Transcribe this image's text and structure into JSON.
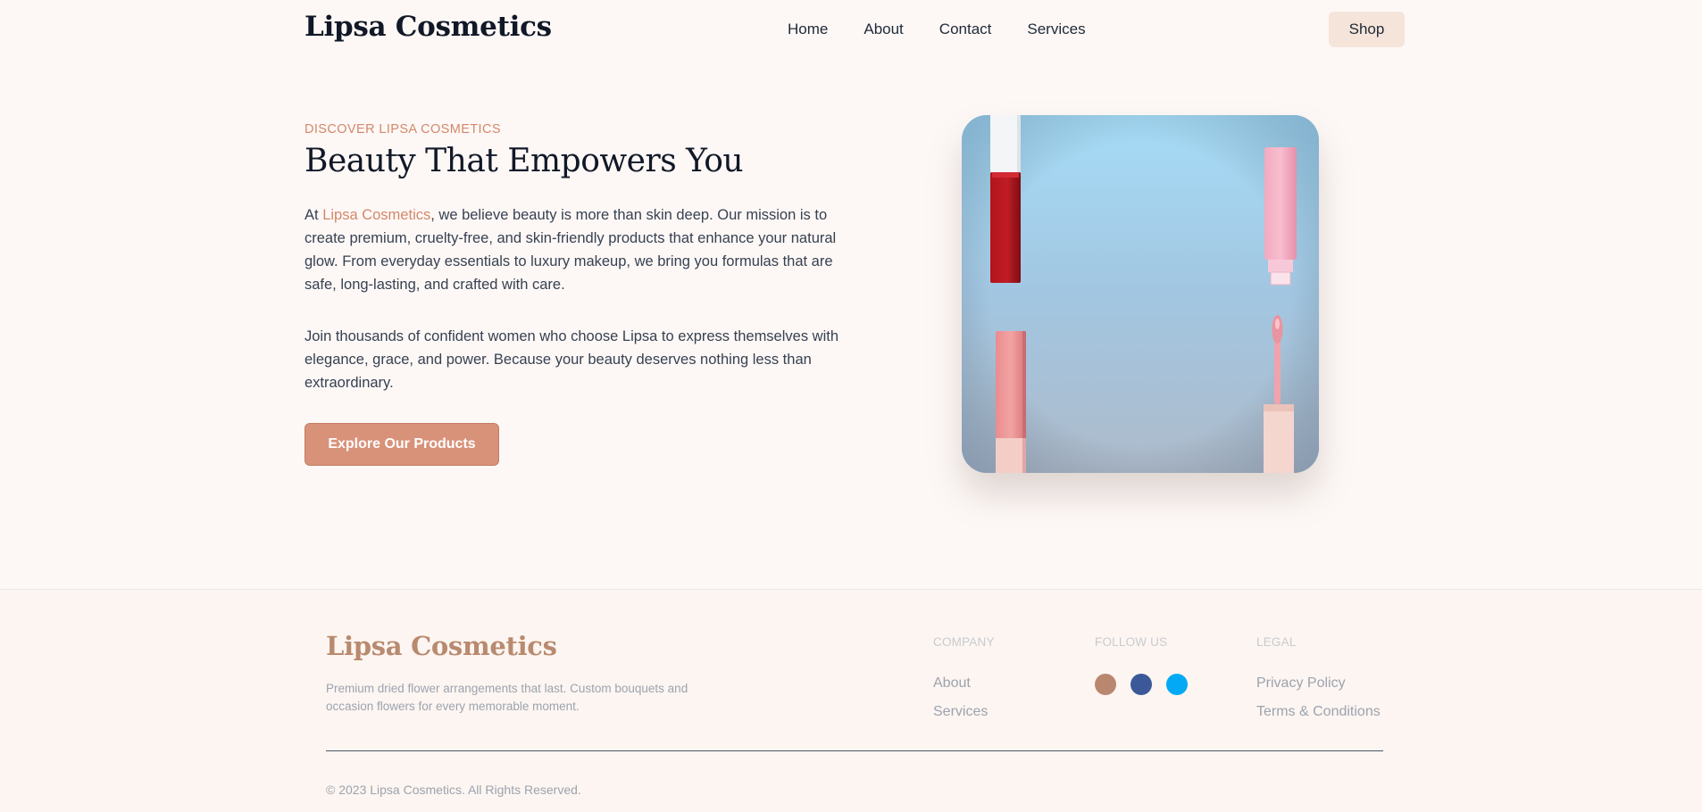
{
  "header": {
    "brand": "Lipsa Cosmetics",
    "nav": [
      "Home",
      "About",
      "Contact",
      "Services"
    ],
    "shop_label": "Shop"
  },
  "hero": {
    "eyebrow": "DISCOVER LIPSA COSMETICS",
    "title": "Beauty That Empowers You",
    "para1_prefix": "At ",
    "para1_brand": "Lipsa Cosmetics",
    "para1_rest": ", we believe beauty is more than skin deep. Our mission is to create premium, cruelty-free, and skin-friendly products that enhance your natural glow. From everyday essentials to luxury makeup, we bring you formulas that are safe, long-lasting, and crafted with care.",
    "para2": "Join thousands of confident women who choose Lipsa to express themselves with elegance, grace, and power. Because your beauty deserves nothing less than extraordinary.",
    "cta_label": "Explore Our Products",
    "image_subject": "lipstick-and-lip-gloss-products-on-blue-background"
  },
  "footer": {
    "brand": "Lipsa Cosmetics",
    "description": "Premium dried flower arrangements that last. Custom bouquets and occasion flowers for every memorable moment.",
    "company_title": "COMPANY",
    "company_links": [
      "About",
      "Services"
    ],
    "follow_title": "FOLLOW US",
    "social": [
      {
        "icon": "instagram-icon",
        "color": "#b9876f"
      },
      {
        "icon": "facebook-icon",
        "color": "#3b5998"
      },
      {
        "icon": "twitter-icon",
        "color": "#03a9f4"
      }
    ],
    "legal_title": "LEGAL",
    "legal_links": [
      "Privacy Policy",
      "Terms & Conditions"
    ],
    "copyright": "© 2023 Lipsa Cosmetics. All Rights Reserved."
  },
  "colors": {
    "background": "#fdf8f6",
    "accent": "#d4876a",
    "cta": "#d9927a",
    "shop_button": "#f5e4da",
    "footer_brand": "#b88a6f"
  }
}
